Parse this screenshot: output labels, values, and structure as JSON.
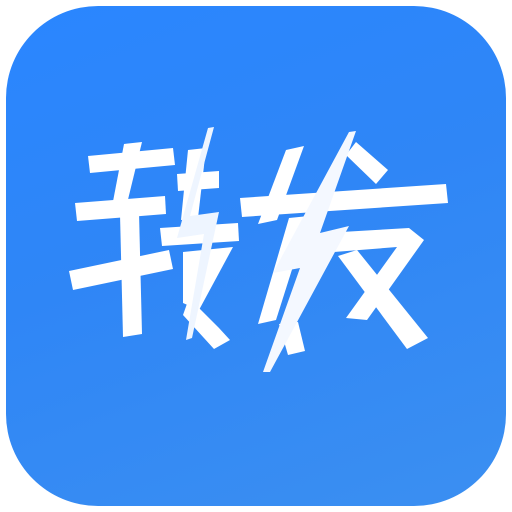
{
  "app_icon": {
    "name": "转发",
    "icon": "lightning-bolt-icon",
    "colors": {
      "background_top": "#2a86ff",
      "background_bottom": "#3b8ff1",
      "glyph": "#ffffff"
    }
  }
}
